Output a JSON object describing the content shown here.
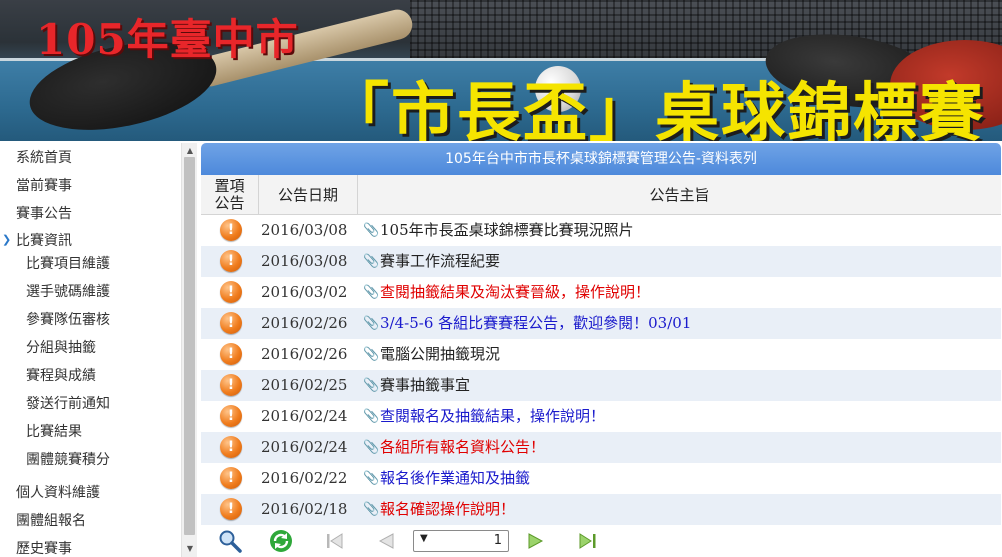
{
  "banner": {
    "year_text": "105年臺中市",
    "title_text": "「市長盃」桌球錦標賽"
  },
  "sidebar": {
    "items": [
      {
        "label": "系統首頁",
        "level": 0
      },
      {
        "label": "當前賽事",
        "level": 0
      },
      {
        "label": "賽事公告",
        "level": 0
      },
      {
        "label": "比賽資訊",
        "level": 0,
        "expanded": true
      },
      {
        "label": "比賽項目維護",
        "level": 1
      },
      {
        "label": "選手號碼維護",
        "level": 1
      },
      {
        "label": "參賽隊伍審核",
        "level": 1
      },
      {
        "label": "分組與抽籤",
        "level": 1
      },
      {
        "label": "賽程與成績",
        "level": 1
      },
      {
        "label": "發送行前通知",
        "level": 1
      },
      {
        "label": "比賽結果",
        "level": 1
      },
      {
        "label": "團體競賽積分",
        "level": 1
      },
      {
        "label": "個人資料維護",
        "level": 0
      },
      {
        "label": "團體組報名",
        "level": 0
      },
      {
        "label": "歷史賽事",
        "level": 0
      }
    ]
  },
  "main": {
    "panel_title": "105年台中市市長杯桌球錦標賽管理公告-資料表列",
    "columns": {
      "pin": "置項\n公告",
      "date": "公告日期",
      "subject": "公告主旨"
    },
    "rows": [
      {
        "date": "2016/03/08",
        "subject": "105年市長盃桌球錦標賽比賽現況照片",
        "color": "#222222"
      },
      {
        "date": "2016/03/08",
        "subject": "賽事工作流程紀要",
        "color": "#222222"
      },
      {
        "date": "2016/03/02",
        "subject": "查閱抽籤結果及淘汰賽晉級，操作說明！",
        "color": "#e00000"
      },
      {
        "date": "2016/02/26",
        "subject": "3/4-5-6 各組比賽賽程公告，歡迎參閱！03/01",
        "color": "#1a1acc"
      },
      {
        "date": "2016/02/26",
        "subject": "電腦公開抽籤現況",
        "color": "#222222"
      },
      {
        "date": "2016/02/25",
        "subject": "賽事抽籤事宜",
        "color": "#222222"
      },
      {
        "date": "2016/02/24",
        "subject": "查閱報名及抽籤結果，操作說明！",
        "color": "#1a1acc"
      },
      {
        "date": "2016/02/24",
        "subject": "各組所有報名資料公告！",
        "color": "#e00000"
      },
      {
        "date": "2016/02/22",
        "subject": "報名後作業通知及抽籤",
        "color": "#1a1acc"
      },
      {
        "date": "2016/02/18",
        "subject": "報名確認操作說明！",
        "color": "#e00000"
      }
    ],
    "pin_icon": "!",
    "clip_icon": "paperclip-icon"
  },
  "pager": {
    "page_value": "1",
    "dropdown_glyph": "▼",
    "icons": [
      "search-icon",
      "refresh-icon",
      "first-page-icon",
      "prev-page-icon",
      "next-page-icon",
      "last-page-icon"
    ]
  }
}
